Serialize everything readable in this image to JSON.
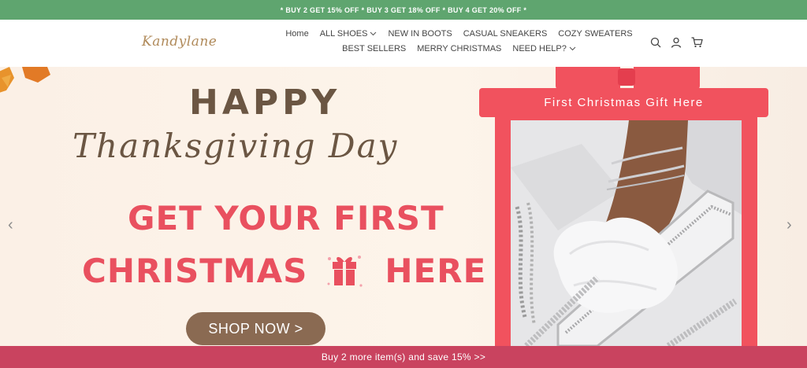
{
  "promo": {
    "text": "* BUY 2 GET 15% OFF * BUY 3 GET 18% OFF * BUY 4 GET 20% OFF *"
  },
  "header": {
    "logo": "Kandylane",
    "nav": [
      {
        "label": "Home",
        "has_caret": false
      },
      {
        "label": "ALL SHOES",
        "has_caret": true
      },
      {
        "label": "NEW IN BOOTS",
        "has_caret": false
      },
      {
        "label": "CASUAL SNEAKERS",
        "has_caret": false
      },
      {
        "label": "COZY SWEATERS",
        "has_caret": false
      },
      {
        "label": "BEST SELLERS",
        "has_caret": false
      },
      {
        "label": "MERRY CHRISTMAS",
        "has_caret": false
      },
      {
        "label": "NEED HELP?",
        "has_caret": true
      }
    ],
    "icons": [
      "search-icon",
      "account-icon",
      "cart-icon"
    ]
  },
  "hero": {
    "happy": "HAPPY",
    "thanksgiving": "Thanksgiving Day",
    "line1": "GET YOUR FIRST",
    "line2_a": "CHRISTMAS",
    "line2_b": "HERE",
    "cta": "SHOP NOW >",
    "gift_title": "First Christmas Gift Here"
  },
  "carousel": {
    "prev": "‹",
    "next": "›"
  },
  "cart_bar": {
    "text": "Buy 2 more item(s) and save 15%  >>"
  },
  "colors": {
    "promo": "#5fa56f",
    "accent": "#e9505f",
    "brown": "#6b5643",
    "cta": "#8a6a52",
    "bottom": "#c9435f"
  }
}
